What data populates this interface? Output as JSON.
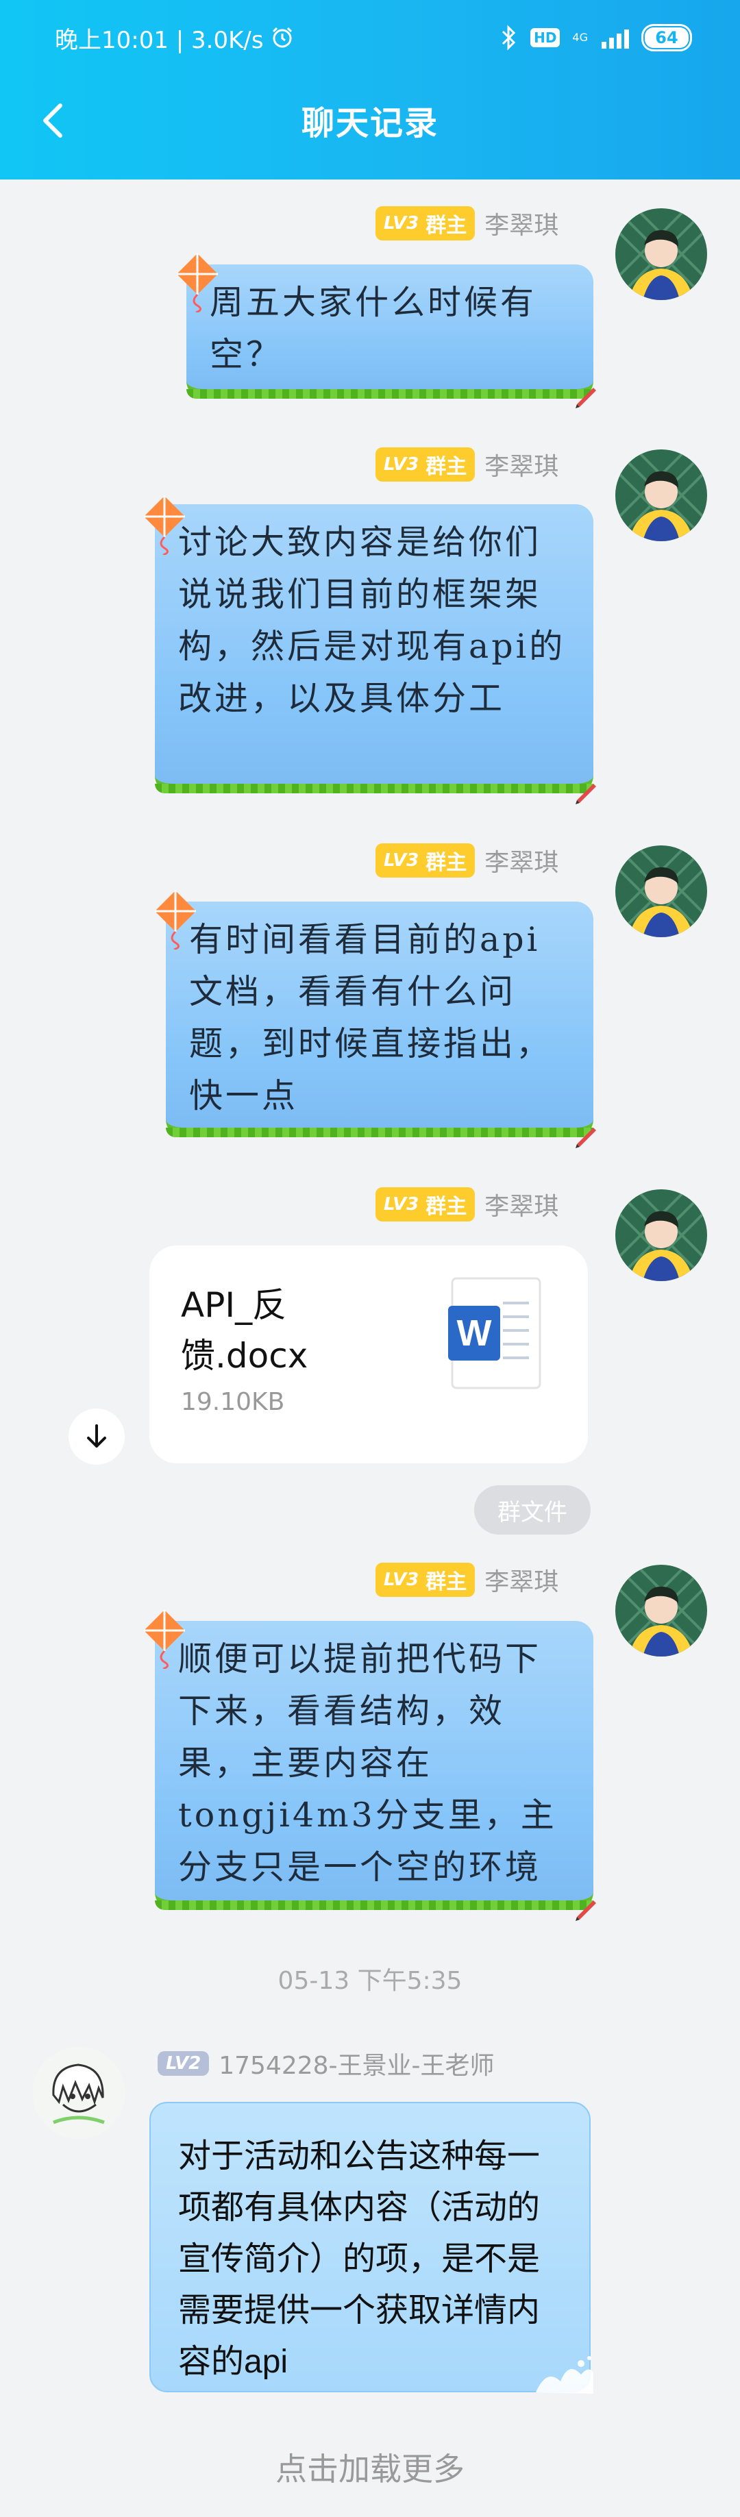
{
  "status_bar": {
    "time_speed": "晚上10:01 | 3.0K/s",
    "hd_label": "HD",
    "network_label": "4G",
    "battery": "64"
  },
  "header": {
    "title": "聊天记录"
  },
  "colors": {
    "header_blue": "#16b4f0",
    "badge_gold": "#ffcc2e",
    "badge_gray": "#b5c0d8",
    "bubble_blue": "#86c5f9",
    "grass_green": "#5fbf2c"
  },
  "messages": [
    {
      "level": "LV3",
      "role": "群主",
      "sender": "李翠琪",
      "text": "周五大家什么时候有空？"
    },
    {
      "level": "LV3",
      "role": "群主",
      "sender": "李翠琪",
      "text": "讨论大致内容是给你们说说我们目前的框架架构，然后是对现有api的改进，以及具体分工"
    },
    {
      "level": "LV3",
      "role": "群主",
      "sender": "李翠琪",
      "text": "有时间看看目前的api文档，看看有什么问题，到时候直接指出，快一点"
    },
    {
      "level": "LV3",
      "role": "群主",
      "sender": "李翠琪",
      "file_name": "API_反馈.docx",
      "file_size": "19.10KB",
      "tag": "群文件"
    },
    {
      "level": "LV3",
      "role": "群主",
      "sender": "李翠琪",
      "text": "顺便可以提前把代码下下来，看看结构，效果，主要内容在tongji4m3分支里，主分支只是一个空的环境"
    }
  ],
  "timestamp": "05-13 下午5:35",
  "reply": {
    "level": "LV2",
    "sender": "1754228-王景业-王老师",
    "text": "对于活动和公告这种每一项都有具体内容（活动的宣传简介）的项，是不是需要提供一个获取详情内容的api"
  },
  "load_more": "点击加载更多"
}
